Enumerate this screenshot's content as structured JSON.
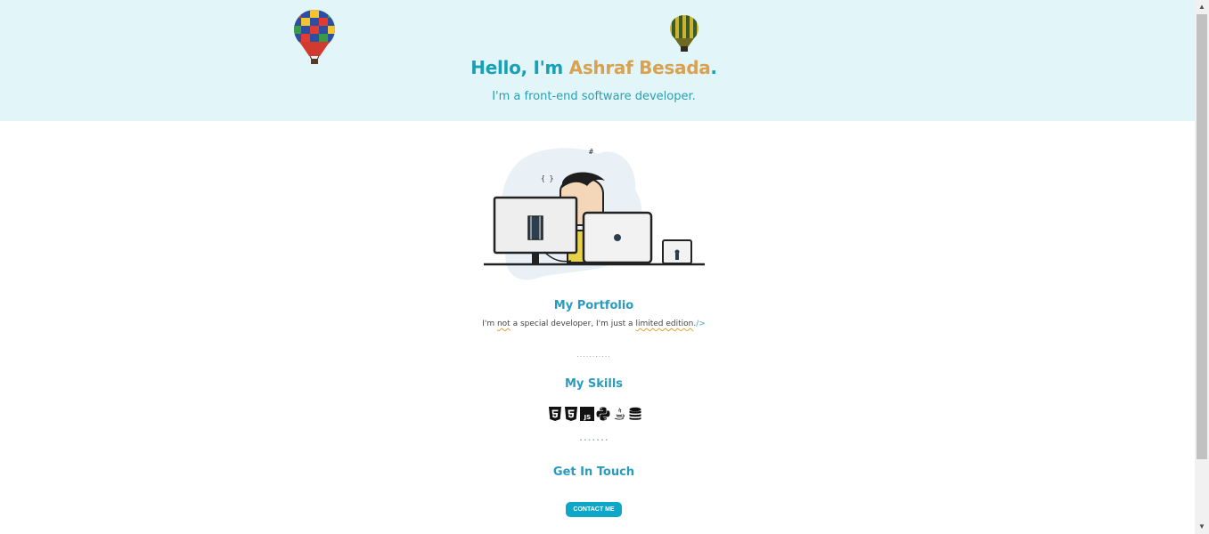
{
  "hero": {
    "greeting": "Hello, I'm ",
    "name": "Ashraf Besada",
    "period": ".",
    "tagline": "I'm a front-end software developer.",
    "bg_color": "#e2f6fa",
    "accent_color": "#19a0b5",
    "name_color": "#d8a250"
  },
  "portfolio": {
    "title": "My Portfolio",
    "quote_pre": "I'm ",
    "quote_not": "not",
    "quote_mid": " a special developer, I'm just a ",
    "quote_limited": "limited edition",
    "quote_end": ".",
    "quote_tag": "/>",
    "dots": "..........."
  },
  "skills": {
    "title": "My Skills",
    "items": [
      {
        "icon": "html5-icon"
      },
      {
        "icon": "css3-icon"
      },
      {
        "icon": "javascript-icon",
        "label": "JS"
      },
      {
        "icon": "python-icon"
      },
      {
        "icon": "java-icon"
      },
      {
        "icon": "database-icon"
      }
    ],
    "dots": "▪ ▪ ▪ ▪ ▪ ▪ ▪"
  },
  "contact": {
    "title": "Get In Touch",
    "button_label": "CONTACT ME",
    "button_color": "#0ea7c7"
  },
  "scrollbar": {
    "up": "▲",
    "down": "▼"
  }
}
